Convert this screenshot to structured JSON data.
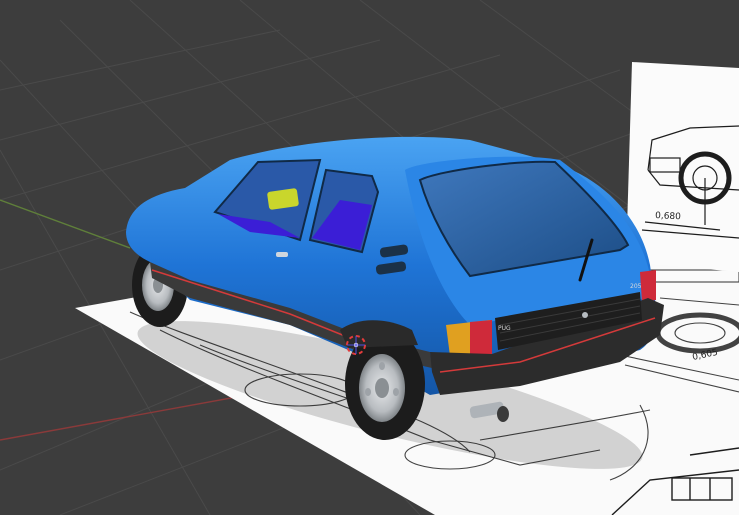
{
  "viewport": {
    "background": "#3d3d3d",
    "grid_color": "#4a4a4a",
    "x_axis_color": "#8a3a3a",
    "y_axis_color": "#5f7f3a"
  },
  "blueprint": {
    "dimension_rear": "0,680",
    "dimension_side": "0,605"
  },
  "car": {
    "body_color": "#1f74d6",
    "badge": "PUG",
    "model_badge": "205"
  }
}
